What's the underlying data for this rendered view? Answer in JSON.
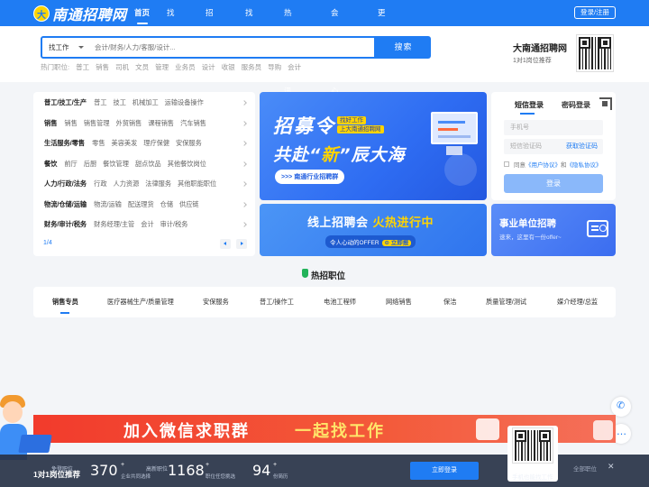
{
  "header": {
    "logo_mark": "大",
    "logo_text": "南通招聘网",
    "nav": [
      "首页",
      "找工作",
      "招人才",
      "找公司",
      "热门资讯",
      "会员中心",
      "更多 »"
    ],
    "login_register": "登录/注册"
  },
  "search": {
    "type_label": "找工作",
    "placeholder": "会计/财务/人力/客服/设计...",
    "button": "搜索",
    "hot_label": "热门职位:",
    "hot_jobs": [
      "普工",
      "销售",
      "司机",
      "文员",
      "管理",
      "业务员",
      "设计",
      "收银",
      "服务员",
      "导购",
      "会计"
    ]
  },
  "brand": {
    "title": "大南通招聘网",
    "subtitle": "1对1岗位推荐"
  },
  "categories": {
    "rows": [
      {
        "title": "普工/技工/生产",
        "subs": [
          "普工",
          "技工",
          "机械加工",
          "运输设备操作"
        ]
      },
      {
        "title": "销售",
        "subs": [
          "销售",
          "销售管理",
          "外贸销售",
          "课程销售",
          "汽车销售"
        ]
      },
      {
        "title": "生活服务/零售",
        "subs": [
          "零售",
          "美容美发",
          "理疗保健",
          "安保服务"
        ]
      },
      {
        "title": "餐饮",
        "subs": [
          "前厅",
          "后厨",
          "餐饮管理",
          "甜点饮品",
          "其他餐饮岗位"
        ]
      },
      {
        "title": "人力/行政/法务",
        "subs": [
          "行政",
          "人力资源",
          "法律服务",
          "其他职能职位"
        ]
      },
      {
        "title": "物流/仓储/运输",
        "subs": [
          "物流/运输",
          "配送理货",
          "仓储",
          "供应链"
        ]
      },
      {
        "title": "财务/审计/税务",
        "subs": [
          "财务经理/主管",
          "会计",
          "审计/税务"
        ]
      }
    ],
    "page": "1/4"
  },
  "banner_recruit": {
    "title": "招募令",
    "tag1": "找好工作",
    "tag2": "上大南通招聘网",
    "line2_a": "共赴“",
    "line2_hl": "新",
    "line2_b": "”辰大海",
    "cta": ">>> 南通行业招聘群"
  },
  "banner_online": {
    "title_a": "线上招聘会 ",
    "title_hl": "火热进行中",
    "sub": "令人心动的OFFER",
    "tag": "立即报",
    "arrow": "⊙"
  },
  "login": {
    "tab_sms": "短信登录",
    "tab_pwd": "密码登录",
    "phone_placeholder": "手机号",
    "code_placeholder": "短信验证码",
    "get_code": "获取验证码",
    "agree_pre": "同意",
    "agree_user": "《用户协议》",
    "agree_and": "和",
    "agree_privacy": "《隐私协议》",
    "submit": "登录"
  },
  "banner_gov": {
    "title": "事业单位招聘",
    "sub": "速来，这里有一份offer~"
  },
  "hot_section": {
    "title": "热招职位",
    "tabs": [
      "销售专员",
      "医疗器械生产/质量管理",
      "安保服务",
      "普工/操作工",
      "电池工程师",
      "网络销售",
      "保洁",
      "质量管理/测试",
      "媒介经理/总监"
    ]
  },
  "wechat_banner": {
    "text": "加入微信求职群",
    "highlight": "一起找工作"
  },
  "bottom_bar": {
    "small_a": "免登职位",
    "small_b": "高新职位",
    "main": "1对1岗位推荐",
    "stats": [
      {
        "num": "370",
        "cap": "企业共同选择"
      },
      {
        "num": "1168",
        "cap": "职位任您挑选"
      },
      {
        "num": "94",
        "cap": "份简历"
      }
    ],
    "login": "立即登录",
    "qr_caption": "手机也能找工作",
    "close_label": "全部职位",
    "close_icon": "✕"
  },
  "colors": {
    "primary": "#1f7cf3",
    "accent_yellow": "#ffd400",
    "wechat_red": "#f23b2c",
    "page_bg": "#f3f5f8"
  }
}
